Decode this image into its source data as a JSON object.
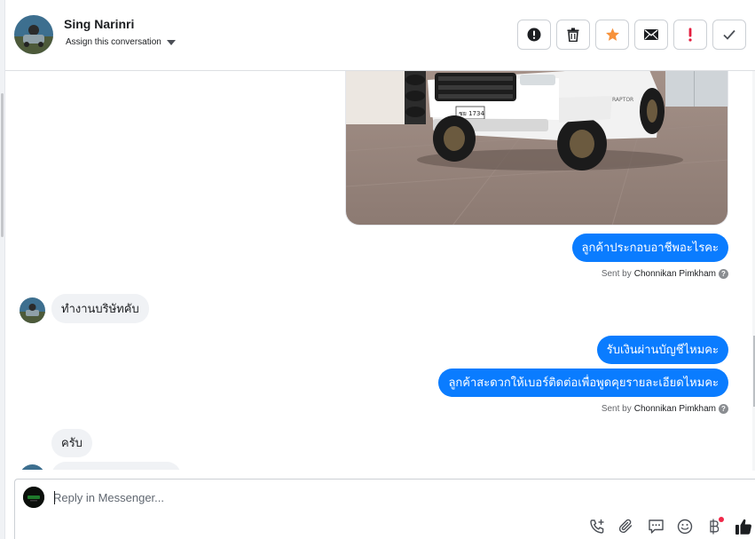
{
  "header": {
    "contact_name": "Sing Narinri",
    "assign_label": "Assign this conversation",
    "actions": [
      {
        "name": "spam-button",
        "icon": "alert-circle-icon"
      },
      {
        "name": "delete-button",
        "icon": "trash-icon"
      },
      {
        "name": "star-button",
        "icon": "star-icon",
        "color": "#f7923b"
      },
      {
        "name": "mark-unread-button",
        "icon": "envelope-icon"
      },
      {
        "name": "follow-up-button",
        "icon": "exclamation-icon",
        "color": "#e41e3f"
      },
      {
        "name": "done-button",
        "icon": "check-icon"
      }
    ]
  },
  "messages": {
    "m1": "ลูกค้าประกอบอาชีพอะไรคะ",
    "m2": "ทำงานบริษัทคับ",
    "m3": "รับเงินผ่านบัญชีไหมคะ",
    "m4": "ลูกค้าสะดวกให้เบอร์ติดต่อเพื่อพูดคุยรายละเอียดไหมคะ",
    "m5": "ครับ"
  },
  "sent_by": {
    "prefix": "Sent by",
    "agent": "Chonnikan Pimkham"
  },
  "composer": {
    "placeholder": "Reply in Messenger...",
    "tools": [
      "phone-add-icon",
      "paperclip-icon",
      "saved-reply-icon",
      "emoji-icon",
      "baht-payment-icon",
      "like-icon"
    ]
  },
  "colors": {
    "accent": "#0a7cff",
    "incoming_bubble": "#f0f2f5",
    "star": "#f7923b",
    "alert": "#e41e3f"
  }
}
